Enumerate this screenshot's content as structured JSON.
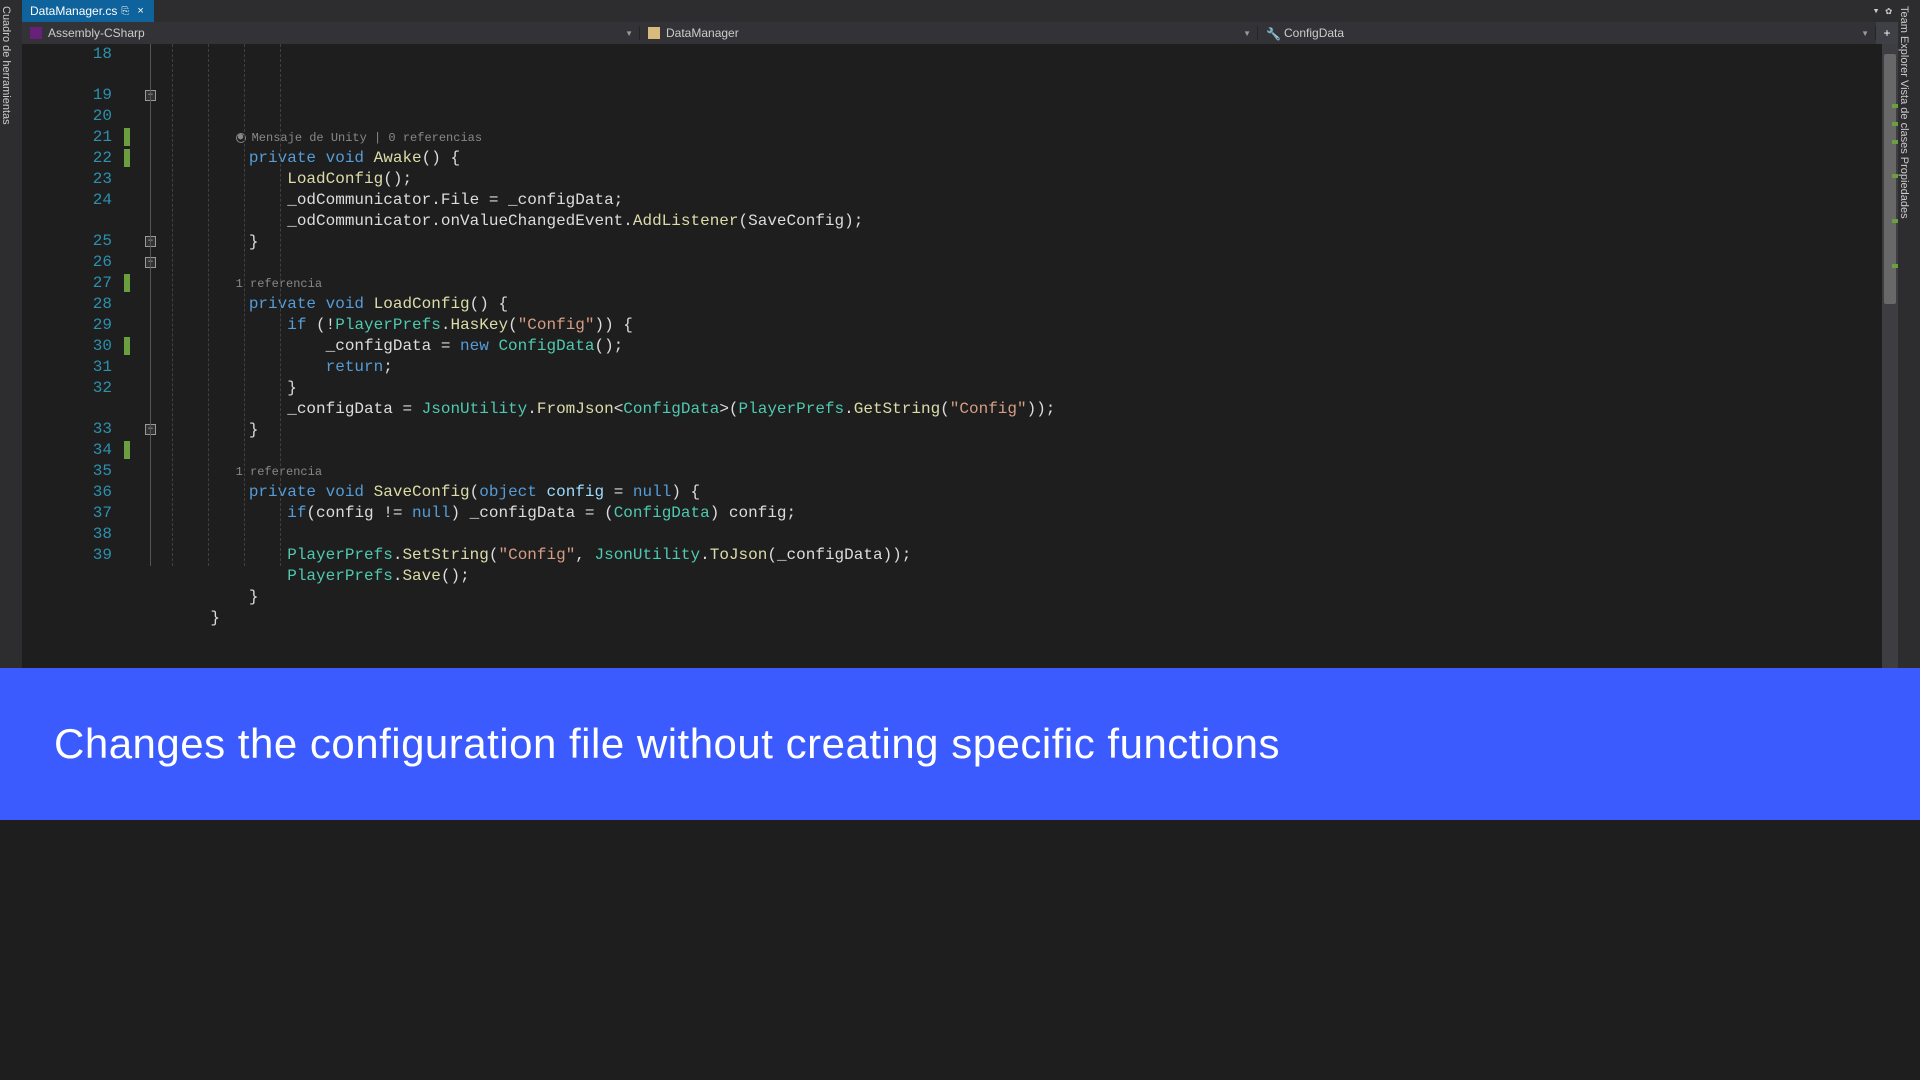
{
  "tab": {
    "filename": "DataManager.cs",
    "close_symbol": "×"
  },
  "breadcrumb": {
    "project": "Assembly-CSharp",
    "class": "DataManager",
    "member": "ConfigData",
    "plus": "+"
  },
  "left_rail": "Cuadro de herramientas",
  "right_rail": "Team Explorer   Vista de clases   Propiedades",
  "hints": {
    "awake": "Mensaje de Unity | 0 referencias",
    "loadconfig": "1 referencia",
    "saveconfig": "1 referencia"
  },
  "line_numbers": [
    18,
    19,
    20,
    21,
    22,
    23,
    24,
    25,
    26,
    27,
    28,
    29,
    30,
    31,
    32,
    33,
    34,
    35,
    36,
    37,
    38,
    39
  ],
  "code": {
    "l18": "",
    "l19": [
      {
        "t": "private ",
        "c": "kw"
      },
      {
        "t": "void ",
        "c": "kw"
      },
      {
        "t": "Awake",
        "c": "method"
      },
      {
        "t": "() {",
        "c": "punct"
      }
    ],
    "l20": [
      {
        "t": "    ",
        "c": ""
      },
      {
        "t": "LoadConfig",
        "c": "method"
      },
      {
        "t": "();",
        "c": "punct"
      }
    ],
    "l21": [
      {
        "t": "    _odCommunicator.File = _configData;",
        "c": "plain"
      }
    ],
    "l22": [
      {
        "t": "    _odCommunicator.onValueChangedEvent.",
        "c": "plain"
      },
      {
        "t": "AddListener",
        "c": "method"
      },
      {
        "t": "(",
        "c": "punct"
      },
      {
        "t": "SaveConfig",
        "c": "plain"
      },
      {
        "t": ");",
        "c": "punct"
      }
    ],
    "l23": [
      {
        "t": "}",
        "c": "punct"
      }
    ],
    "l24": "",
    "l25": [
      {
        "t": "private ",
        "c": "kw"
      },
      {
        "t": "void ",
        "c": "kw"
      },
      {
        "t": "LoadConfig",
        "c": "method"
      },
      {
        "t": "() {",
        "c": "punct"
      }
    ],
    "l26": [
      {
        "t": "    ",
        "c": ""
      },
      {
        "t": "if ",
        "c": "kw"
      },
      {
        "t": "(!",
        "c": "punct"
      },
      {
        "t": "PlayerPrefs",
        "c": "type"
      },
      {
        "t": ".",
        "c": "punct"
      },
      {
        "t": "HasKey",
        "c": "method"
      },
      {
        "t": "(",
        "c": "punct"
      },
      {
        "t": "\"Config\"",
        "c": "str"
      },
      {
        "t": ")) {",
        "c": "punct"
      }
    ],
    "l27": [
      {
        "t": "        _configData = ",
        "c": "plain"
      },
      {
        "t": "new ",
        "c": "kw"
      },
      {
        "t": "ConfigData",
        "c": "type"
      },
      {
        "t": "();",
        "c": "punct"
      }
    ],
    "l28": [
      {
        "t": "        ",
        "c": ""
      },
      {
        "t": "return",
        "c": "kw"
      },
      {
        "t": ";",
        "c": "punct"
      }
    ],
    "l29": [
      {
        "t": "    }",
        "c": "punct"
      }
    ],
    "l30": [
      {
        "t": "    _configData = ",
        "c": "plain"
      },
      {
        "t": "JsonUtility",
        "c": "type"
      },
      {
        "t": ".",
        "c": "punct"
      },
      {
        "t": "FromJson",
        "c": "method"
      },
      {
        "t": "<",
        "c": "punct"
      },
      {
        "t": "ConfigData",
        "c": "type"
      },
      {
        "t": ">(",
        "c": "punct"
      },
      {
        "t": "PlayerPrefs",
        "c": "type"
      },
      {
        "t": ".",
        "c": "punct"
      },
      {
        "t": "GetString",
        "c": "method"
      },
      {
        "t": "(",
        "c": "punct"
      },
      {
        "t": "\"Config\"",
        "c": "str"
      },
      {
        "t": "));",
        "c": "punct"
      }
    ],
    "l31": [
      {
        "t": "}",
        "c": "punct"
      }
    ],
    "l32": "",
    "l33": [
      {
        "t": "private ",
        "c": "kw"
      },
      {
        "t": "void ",
        "c": "kw"
      },
      {
        "t": "SaveConfig",
        "c": "method"
      },
      {
        "t": "(",
        "c": "punct"
      },
      {
        "t": "object ",
        "c": "kw"
      },
      {
        "t": "config",
        "c": "param"
      },
      {
        "t": " = ",
        "c": "punct"
      },
      {
        "t": "null",
        "c": "kw"
      },
      {
        "t": ") {",
        "c": "punct"
      }
    ],
    "l34": [
      {
        "t": "    ",
        "c": ""
      },
      {
        "t": "if",
        "c": "kw"
      },
      {
        "t": "(",
        "c": "punct"
      },
      {
        "t": "config",
        "c": "plain"
      },
      {
        "t": " != ",
        "c": "punct"
      },
      {
        "t": "null",
        "c": "kw"
      },
      {
        "t": ") _configData = (",
        "c": "plain"
      },
      {
        "t": "ConfigData",
        "c": "type"
      },
      {
        "t": ") config;",
        "c": "plain"
      }
    ],
    "l35": "",
    "l36": [
      {
        "t": "    ",
        "c": ""
      },
      {
        "t": "PlayerPrefs",
        "c": "type"
      },
      {
        "t": ".",
        "c": "punct"
      },
      {
        "t": "SetString",
        "c": "method"
      },
      {
        "t": "(",
        "c": "punct"
      },
      {
        "t": "\"Config\"",
        "c": "str"
      },
      {
        "t": ", ",
        "c": "punct"
      },
      {
        "t": "JsonUtility",
        "c": "type"
      },
      {
        "t": ".",
        "c": "punct"
      },
      {
        "t": "ToJson",
        "c": "method"
      },
      {
        "t": "(_configData));",
        "c": "plain"
      }
    ],
    "l37": [
      {
        "t": "    ",
        "c": ""
      },
      {
        "t": "PlayerPrefs",
        "c": "type"
      },
      {
        "t": ".",
        "c": "punct"
      },
      {
        "t": "Save",
        "c": "method"
      },
      {
        "t": "();",
        "c": "punct"
      }
    ],
    "l38": [
      {
        "t": "}",
        "c": "punct"
      }
    ],
    "l39_prefix": "",
    "l39": [
      {
        "t": "}",
        "c": "punct"
      }
    ]
  },
  "banner_text": "Changes the configuration file without creating specific functions"
}
